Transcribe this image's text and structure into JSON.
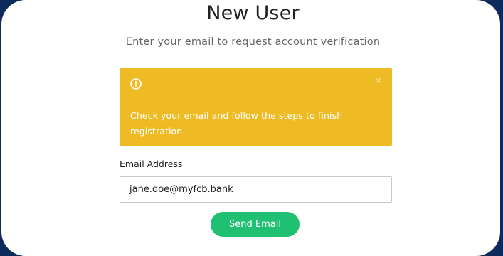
{
  "page": {
    "title": "New User",
    "subtitle": "Enter your email to request account verification"
  },
  "alert": {
    "icon": "exclamation-circle-icon",
    "close_icon": "close-icon",
    "close_glyph": "×",
    "message": "Check your email and follow the steps to finish registration.",
    "background_color": "#eebb25"
  },
  "form": {
    "email_label": "Email Address",
    "email_value": "jane.doe@myfcb.bank",
    "send_button_label": "Send Email",
    "button_color": "#1fc072"
  }
}
